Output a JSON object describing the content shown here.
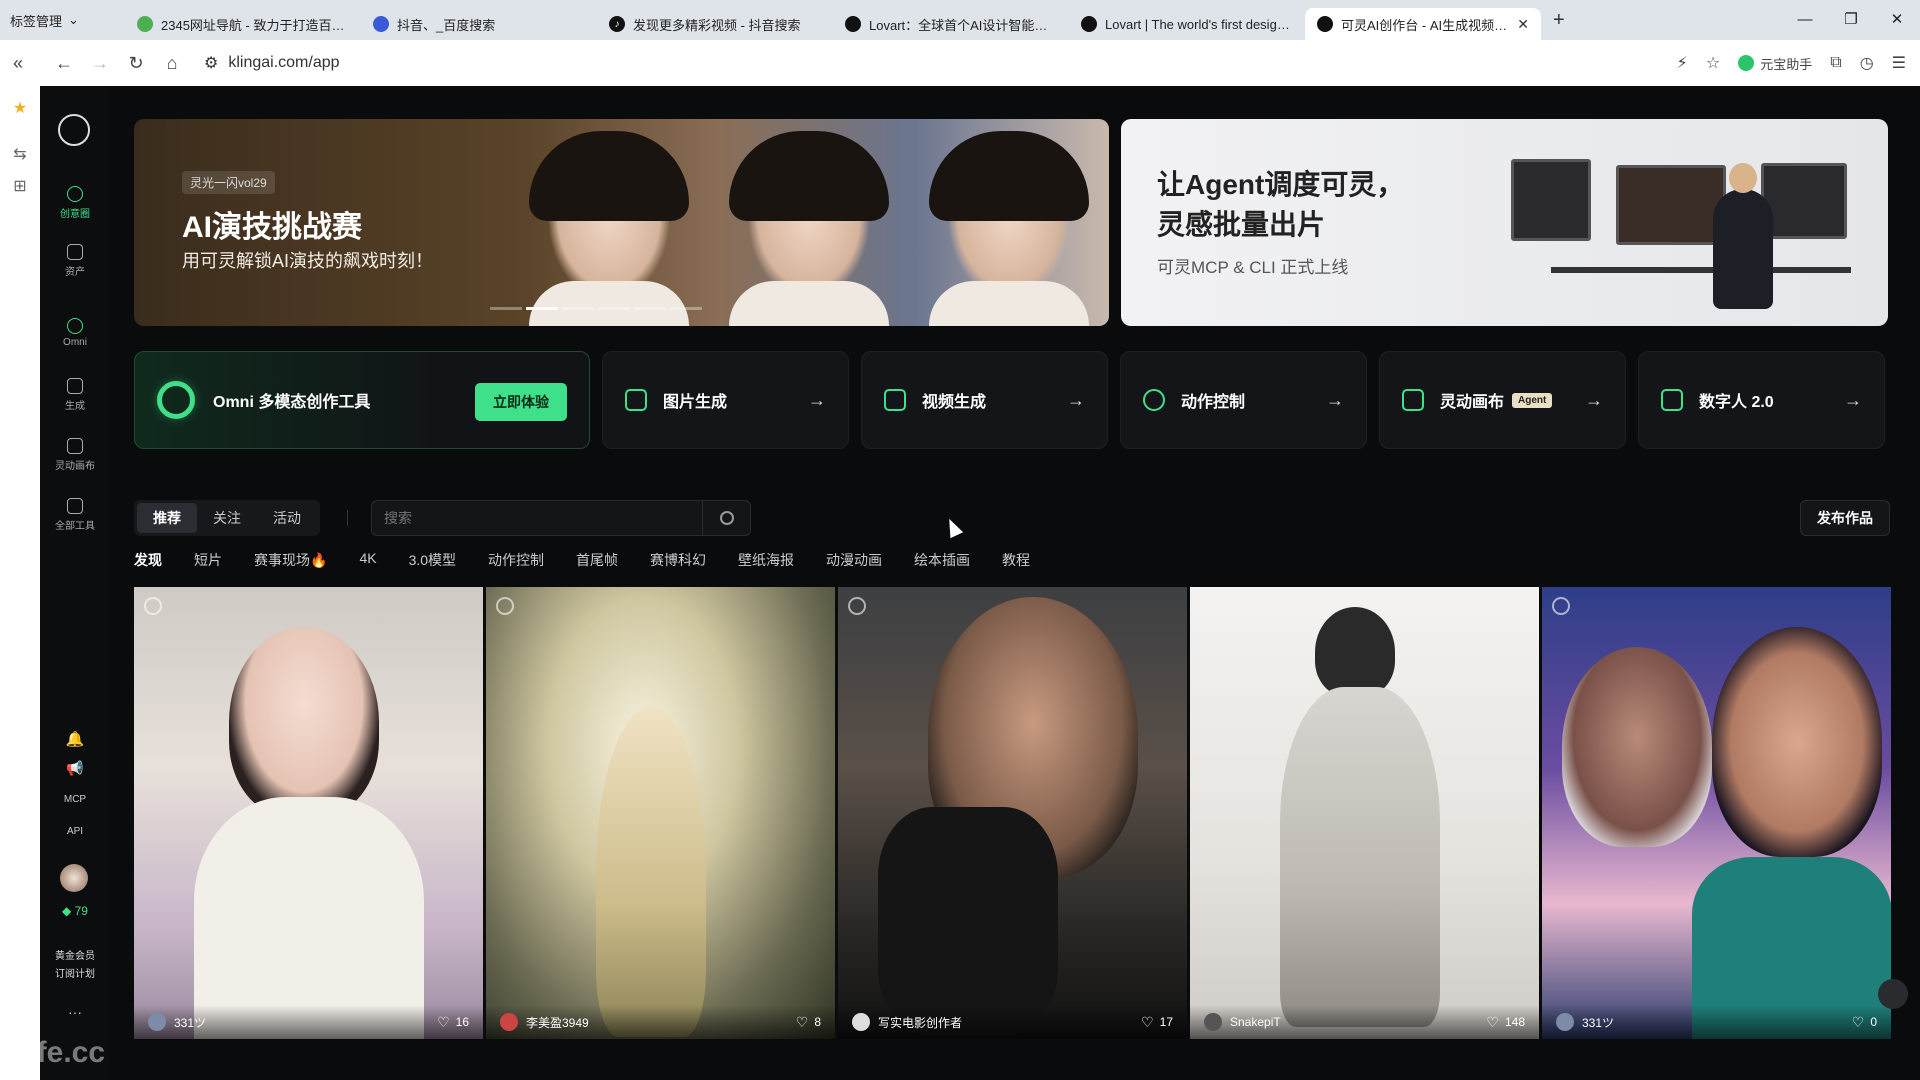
{
  "browser": {
    "tab_manager": "标签管理",
    "tabs": [
      {
        "title": "2345网址导航 - 致力于打造百年品牌"
      },
      {
        "title": "抖音、_百度搜索"
      },
      {
        "title": "发现更多精彩视频 - 抖音搜索"
      },
      {
        "title": "Lovart：全球首个AI设计智能体 | E"
      },
      {
        "title": "Lovart | The world's first design a"
      },
      {
        "title": "可灵AI创作台 - AI生成视频与图"
      }
    ],
    "url": "klingai.com/app",
    "assistant": "元宝助手"
  },
  "sidebar": {
    "items": [
      {
        "label": "创意圈"
      },
      {
        "label": "资产"
      },
      {
        "label": "Omni"
      },
      {
        "label": "生成"
      },
      {
        "label": "灵动画布"
      },
      {
        "label": "全部工具"
      }
    ],
    "mcp": "MCP",
    "api": "API",
    "credits": "79",
    "member_line1": "黄金会员",
    "member_line2": "订阅计划",
    "more": "···"
  },
  "banner_left": {
    "tag": "灵光一闪vol29",
    "title": "AI演技挑战赛",
    "subtitle": "用可灵解锁AI演技的飙戏时刻！"
  },
  "banner_right": {
    "title": "让Agent调度可灵，\n灵感批量出片",
    "subtitle": "可灵MCP & CLI 正式上线"
  },
  "tools": {
    "omni": {
      "label": "Omni 多模态创作工具",
      "button": "立即体验"
    },
    "image": {
      "label": "图片生成"
    },
    "video": {
      "label": "视频生成"
    },
    "motion": {
      "label": "动作控制"
    },
    "canvas": {
      "label": "灵动画布",
      "badge": "Agent"
    },
    "avatar": {
      "label": "数字人 2.0"
    },
    "arrow": "→"
  },
  "feed": {
    "tabs": [
      "推荐",
      "关注",
      "活动"
    ],
    "search_placeholder": "搜索",
    "publish": "发布作品",
    "categories": [
      "发现",
      "短片",
      "赛事现场🔥",
      "4K",
      "3.0模型",
      "动作控制",
      "首尾帧",
      "赛博科幻",
      "壁纸海报",
      "动漫动画",
      "绘本插画",
      "教程"
    ],
    "cards": [
      {
        "user": "331ツ",
        "likes": "16"
      },
      {
        "user": "李美盈3949",
        "likes": "8"
      },
      {
        "user": "写实电影创作者",
        "likes": "17"
      },
      {
        "user": "SnakepiT",
        "likes": "148"
      },
      {
        "user": "331ツ",
        "likes": "0"
      }
    ]
  },
  "watermark": "tafe.cc",
  "colors": {
    "accent": "#3ee08a",
    "background": "#0a0b0d"
  }
}
